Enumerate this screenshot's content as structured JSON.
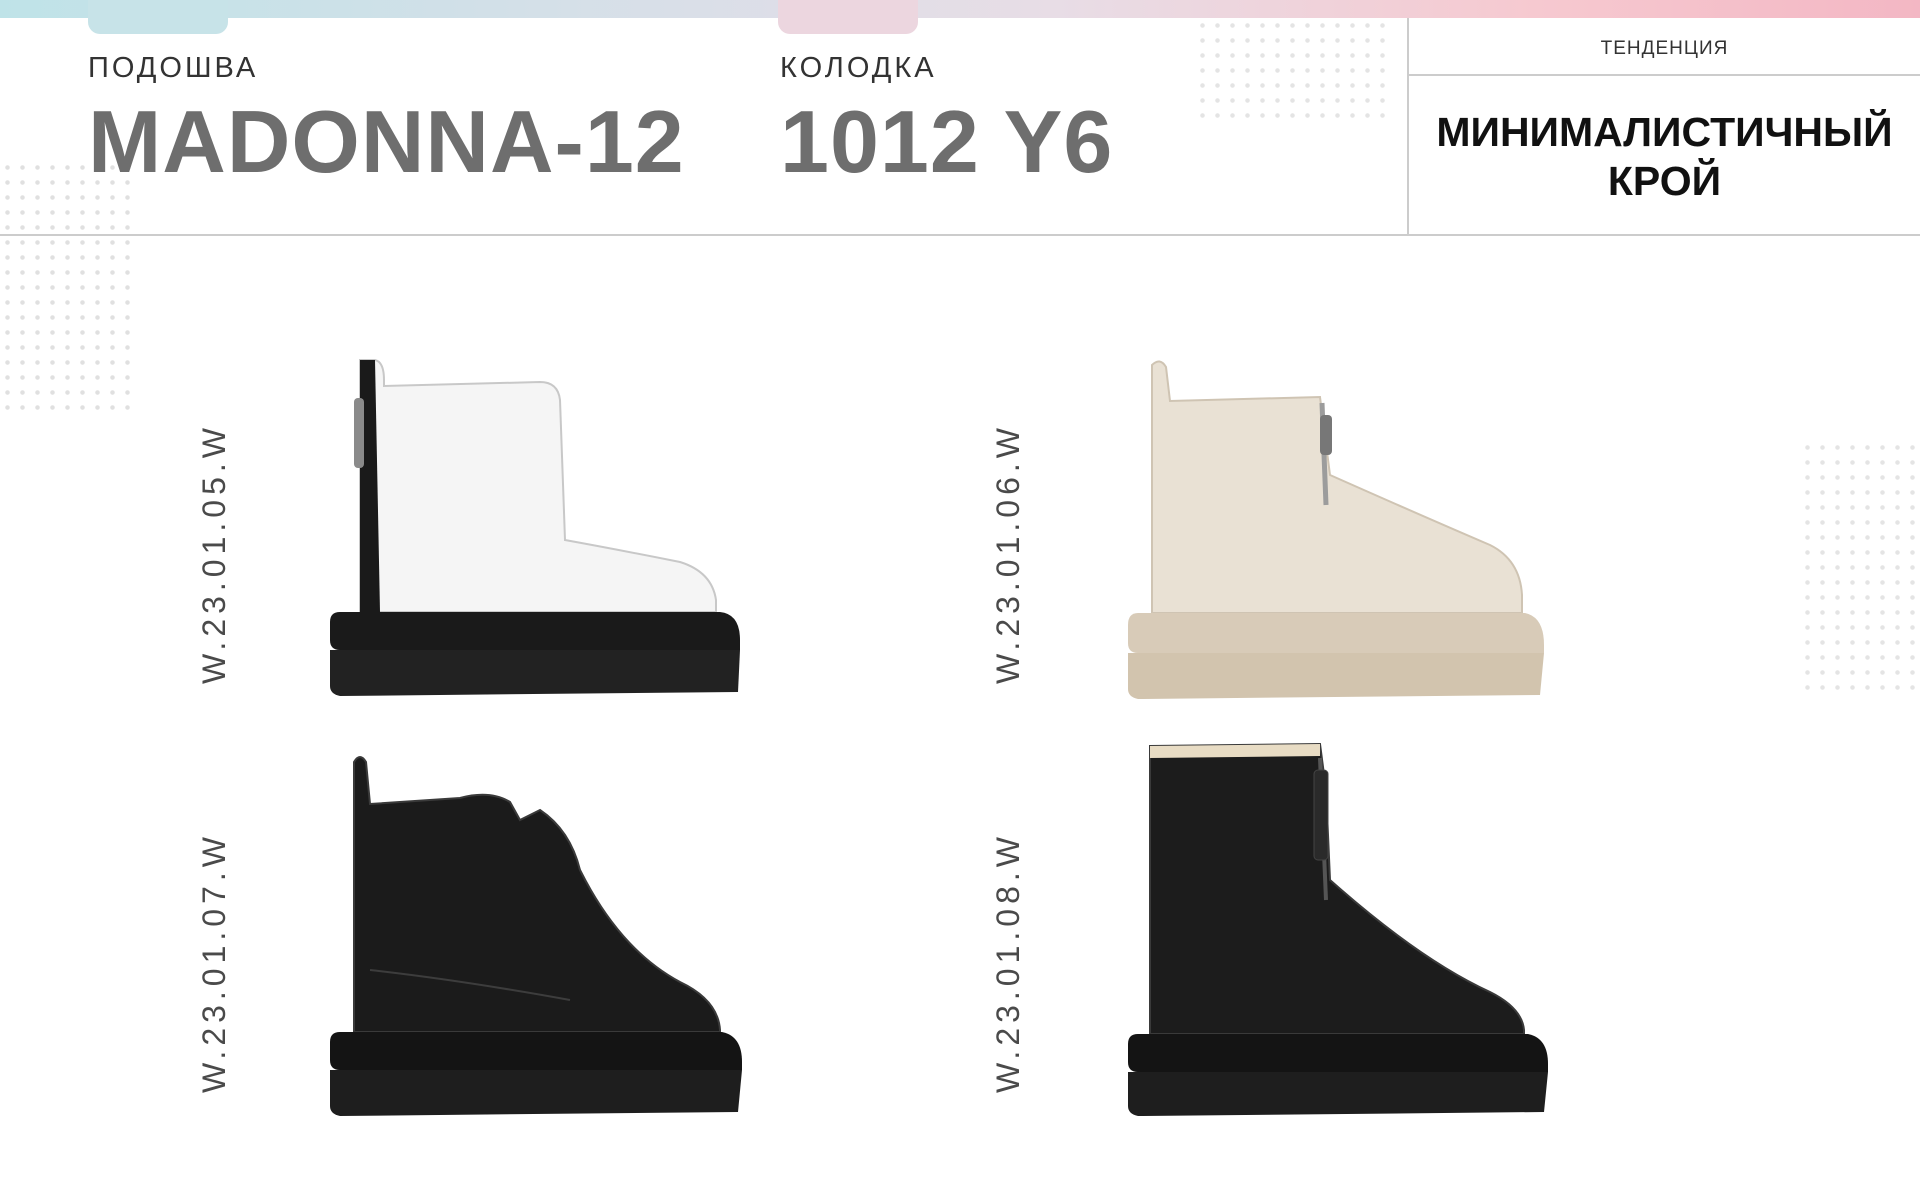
{
  "header": {
    "sole_label": "ПОДОШВА",
    "sole_value": "MADONNA-12",
    "last_label": "КОЛОДКА",
    "last_value": "1012 Y6",
    "trend_label": "ТЕНДЕНЦИЯ",
    "trend_value_line1": "МИНИМАЛИСТИЧНЫЙ",
    "trend_value_line2": "КРОЙ"
  },
  "products": [
    {
      "code": "W.23.01.05.W",
      "upper_color": "#f5f5f5",
      "sole_color": "#1a1a1a"
    },
    {
      "code": "W.23.01.06.W",
      "upper_color": "#e9e1d4",
      "sole_color": "#d8cbb8"
    },
    {
      "code": "W.23.01.07.W",
      "upper_color": "#1b1b1b",
      "sole_color": "#141414"
    },
    {
      "code": "W.23.01.08.W",
      "upper_color": "#1c1c1c",
      "sole_color": "#141414"
    }
  ]
}
